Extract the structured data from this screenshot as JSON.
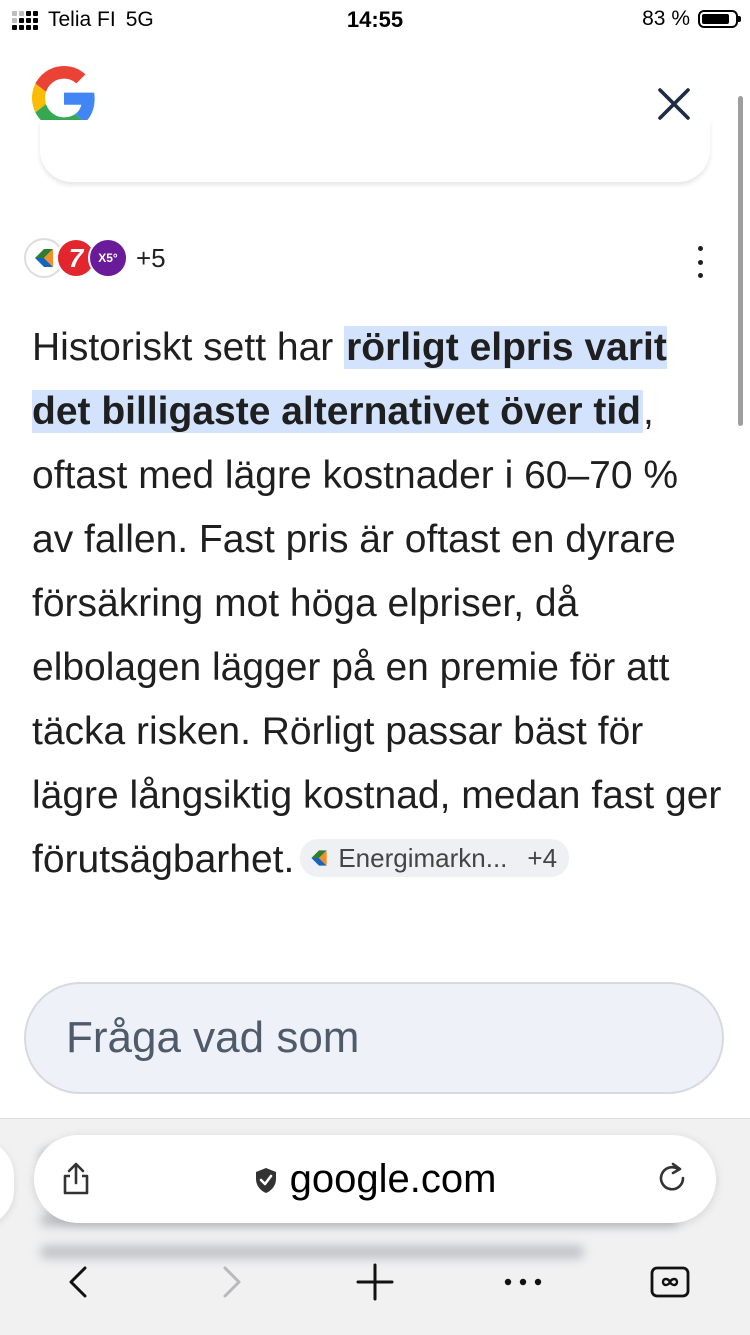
{
  "status_bar": {
    "carrier": "Telia FI",
    "network": "5G",
    "time": "14:55",
    "battery": "83 %",
    "battery_level": 0.83
  },
  "header": {
    "logo_icon": "google-g-icon",
    "close_icon": "close-icon"
  },
  "sources": {
    "icons": [
      "energimarknadsinspektionen-icon",
      "seven-icon",
      "x5-icon"
    ],
    "more_count": "+5"
  },
  "answer": {
    "intro": "Historiskt sett har ",
    "highlight": "rörligt elpris varit det billigaste alternativet över tid",
    "body": ", oftast med lägre kostnader i 60–70 % av fallen. Fast pris är oftast en dyrare försäkring mot höga elpriser, då elbolagen lägger på en premie för att täcka risken. Rörligt passar bäst för lägre långsiktig kostnad, medan fast ger förutsägbarhet.",
    "citation": {
      "label": "Energimarkn...",
      "more": "+4"
    }
  },
  "ask": {
    "placeholder": "Fråga vad som"
  },
  "browser": {
    "url": "google.com",
    "icons": [
      "share-icon",
      "shield-icon",
      "reload-icon",
      "back-icon",
      "forward-icon",
      "new-tab-icon",
      "more-icon",
      "tabs-icon"
    ]
  },
  "colors": {
    "highlight": "#d3e3fd",
    "ask_background": "#eef1f7",
    "text": "#1f1f1f"
  }
}
